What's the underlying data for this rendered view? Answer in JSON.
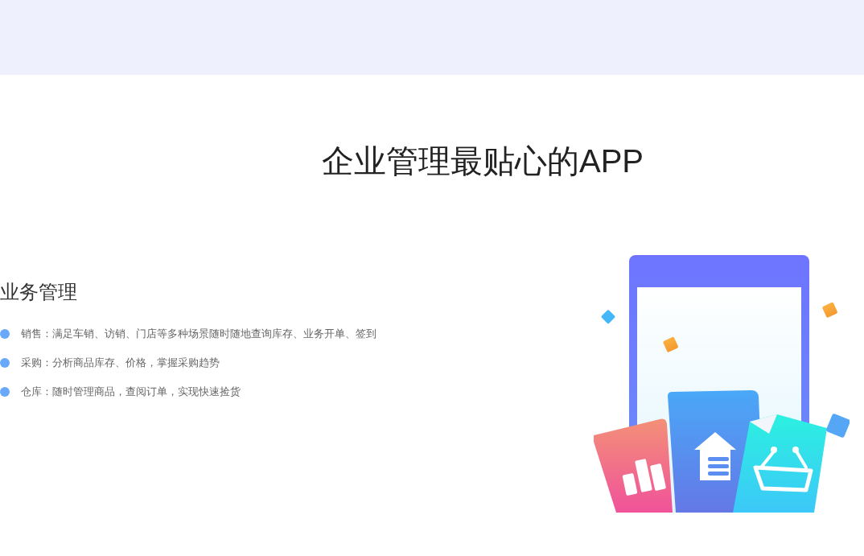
{
  "title": "企业管理最贴心的APP",
  "section": {
    "heading": "业务管理",
    "items": [
      {
        "text": "销售：满足车销、访销、门店等多种场景随时随地查询库存、业务开单、签到"
      },
      {
        "text": "采购：分析商品库存、价格，掌握采购趋势"
      },
      {
        "text": "仓库：随时管理商品，查阅订单，实现快速捡货"
      }
    ]
  }
}
